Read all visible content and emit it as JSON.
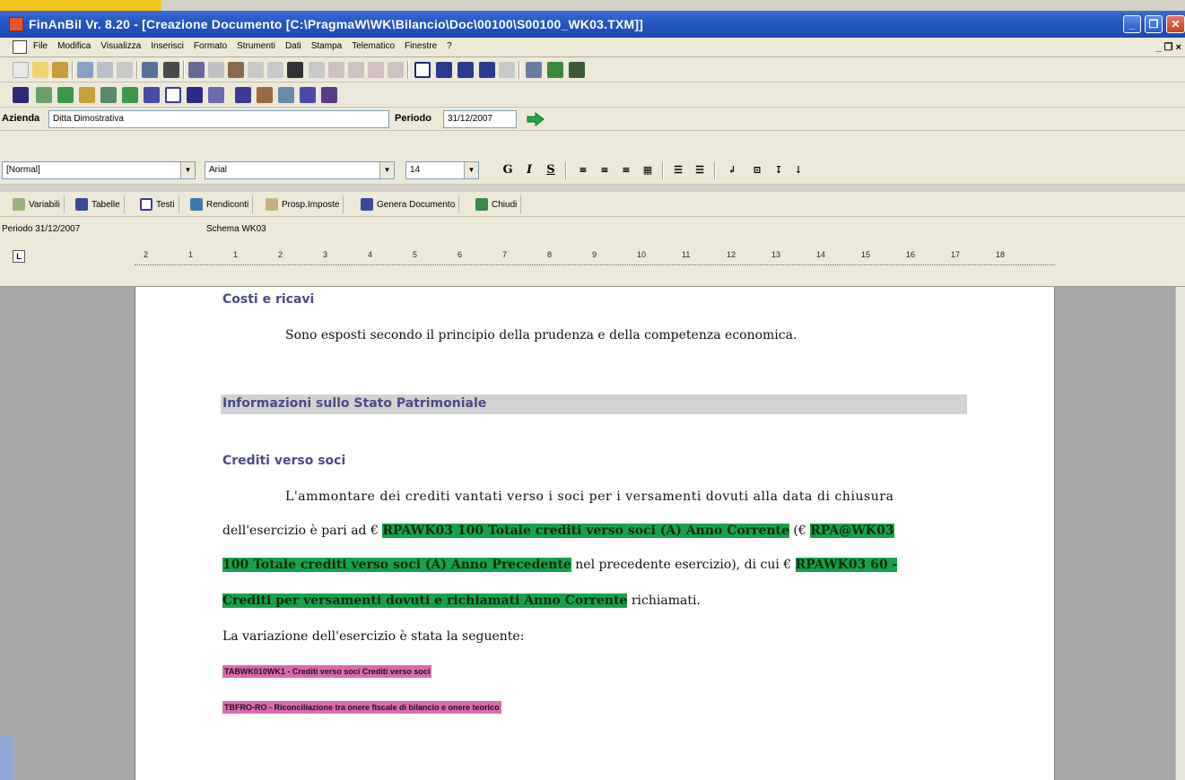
{
  "window": {
    "title": "FinAnBil  Vr. 8.20 - [Creazione Documento [C:\\PragmaW\\WK\\Bilancio\\Doc\\00100\\S00100_WK03.TXM]]",
    "min_label": "_",
    "max_label": "❐",
    "close_label": "✕"
  },
  "menu": {
    "items": [
      "File",
      "Modifica",
      "Visualizza",
      "Inserisci",
      "Formato",
      "Strumenti",
      "Dati",
      "Stampa",
      "Telematico",
      "Finestre",
      "?"
    ],
    "right_controls": "_ ❐ ×"
  },
  "azienda": {
    "label": "Azienda",
    "value": "Ditta Dimostrativa",
    "periodo_label": "Periodo",
    "periodo_value": "31/12/2007"
  },
  "format": {
    "style": "[Normal]",
    "font": "Arial",
    "size": "14",
    "bold": "G",
    "italic": "I",
    "underline": "S"
  },
  "commands": [
    "Variabili",
    "Tabelle",
    "Testi",
    "Rendiconti",
    "Prosp.Imposte",
    "Genera Documento",
    "Chiudi"
  ],
  "status": {
    "periodo": "Periodo 31/12/2007",
    "schema": "Schema WK03"
  },
  "ruler": {
    "ticks": [
      "2",
      "1",
      "1",
      "2",
      "3",
      "4",
      "5",
      "6",
      "7",
      "8",
      "9",
      "10",
      "11",
      "12",
      "13",
      "14",
      "15",
      "16",
      "17",
      "18"
    ]
  },
  "document": {
    "h1": "Costi e ricavi",
    "p1": "Sono esposti secondo il principio della prudenza e della competenza economica.",
    "section_title": "Informazioni sullo Stato Patrimoniale",
    "h2": "Crediti verso soci",
    "line1": "L'ammontare dei crediti vantati verso i soci per i versamenti dovuti alla data di chiusura",
    "line2_a": "dell'esercizio è pari ad € ",
    "line2_var": "RPAWK03 100 Totale crediti verso soci (A) Anno Corrente",
    "line2_b": " (€ ",
    "line2_var2": "RPA@WK03",
    "line3_var": "100 Totale crediti verso soci (A) Anno Precedente",
    "line3_b": " nel precedente esercizio), di cui € ",
    "line3_var2": "RPAWK03 60 -",
    "line4_var": "Crediti per versamenti dovuti e richiamati Anno Corrente",
    "line4_b": " richiamati.",
    "line5": "La variazione dell'esercizio è stata la seguente:",
    "table1": "TABWK010WK1 - Crediti verso soci Crediti verso soci",
    "table2": "TBFRO-RO - Riconciliazione tra onere fiscale di bilancio e onere teorico"
  }
}
